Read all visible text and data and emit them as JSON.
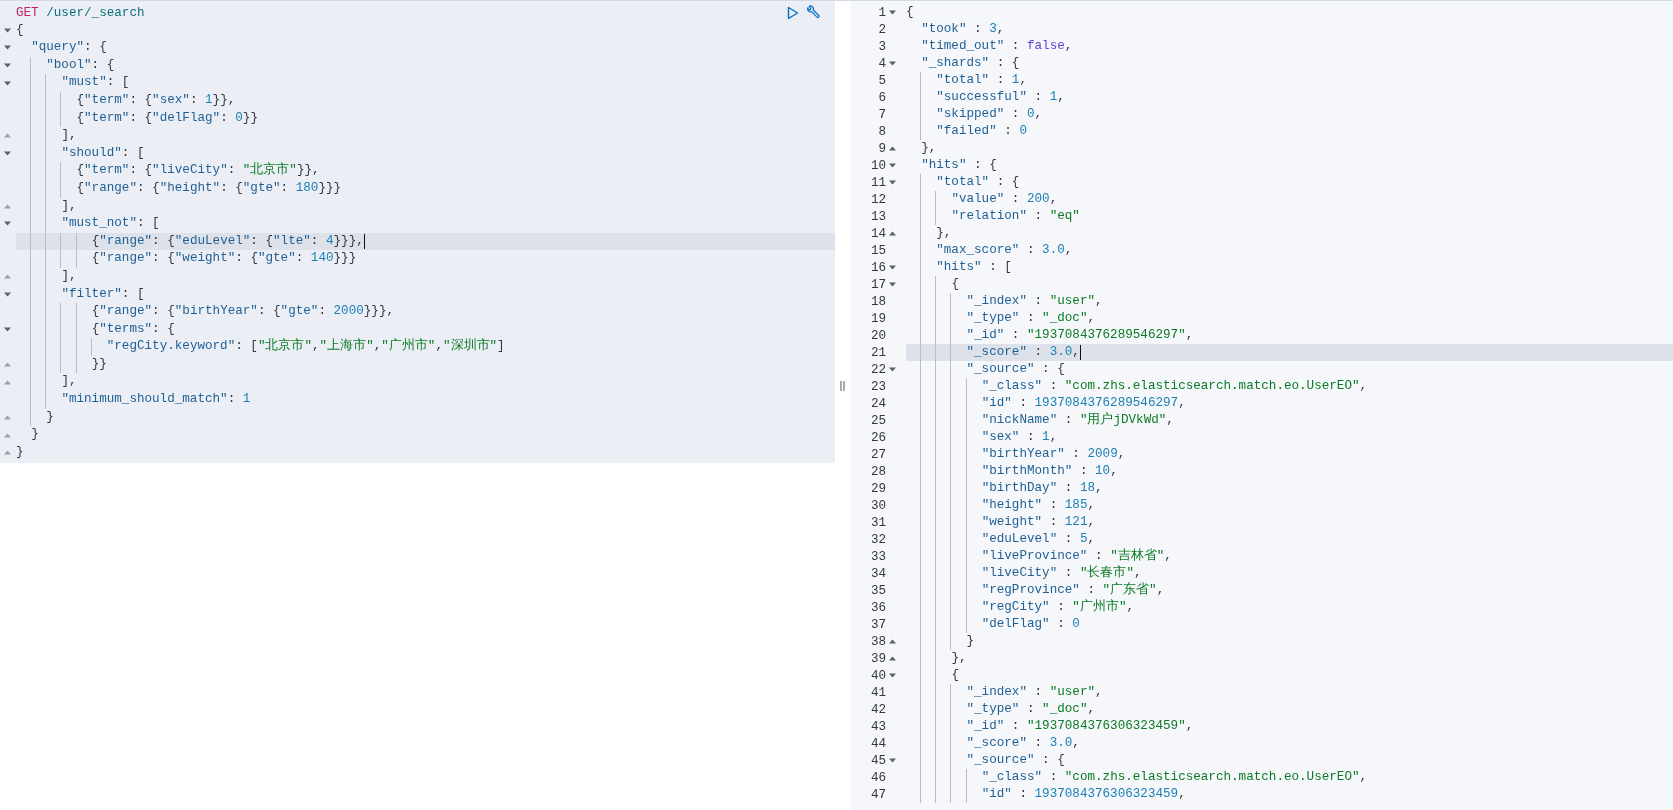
{
  "request_editor": {
    "method": "GET",
    "path": "/user/_search",
    "lines": [
      {
        "text": "{",
        "fold_start": true,
        "fold_end": false,
        "active": false
      },
      {
        "text": "  \"query\": {",
        "fold_start": true,
        "fold_end": false,
        "active": false
      },
      {
        "text": "    \"bool\": {",
        "fold_start": true,
        "fold_end": false,
        "active": false
      },
      {
        "text": "      \"must\": [",
        "fold_start": true,
        "fold_end": false,
        "active": false
      },
      {
        "text": "        {\"term\": {\"sex\": 1}},",
        "fold_start": false,
        "fold_end": false,
        "active": false
      },
      {
        "text": "        {\"term\": {\"delFlag\": 0}}",
        "fold_start": false,
        "fold_end": false,
        "active": false
      },
      {
        "text": "      ],",
        "fold_start": false,
        "fold_end": true,
        "active": false
      },
      {
        "text": "      \"should\": [",
        "fold_start": true,
        "fold_end": false,
        "active": false
      },
      {
        "text": "        {\"term\": {\"liveCity\": \"北京市\"}},",
        "fold_start": false,
        "fold_end": false,
        "active": false
      },
      {
        "text": "        {\"range\": {\"height\": {\"gte\": 180}}}",
        "fold_start": false,
        "fold_end": false,
        "active": false
      },
      {
        "text": "      ],",
        "fold_start": false,
        "fold_end": true,
        "active": false
      },
      {
        "text": "      \"must_not\": [",
        "fold_start": true,
        "fold_end": false,
        "active": false
      },
      {
        "text": "          {\"range\": {\"eduLevel\": {\"lte\": 4}}},",
        "fold_start": false,
        "fold_end": false,
        "active": true
      },
      {
        "text": "          {\"range\": {\"weight\": {\"gte\": 140}}}",
        "fold_start": false,
        "fold_end": false,
        "active": false
      },
      {
        "text": "      ],",
        "fold_start": false,
        "fold_end": true,
        "active": false
      },
      {
        "text": "      \"filter\": [",
        "fold_start": true,
        "fold_end": false,
        "active": false
      },
      {
        "text": "          {\"range\": {\"birthYear\": {\"gte\": 2000}}},",
        "fold_start": false,
        "fold_end": false,
        "active": false
      },
      {
        "text": "          {\"terms\": {",
        "fold_start": true,
        "fold_end": false,
        "active": false
      },
      {
        "text": "            \"regCity.keyword\": [\"北京市\",\"上海市\",\"广州市\",\"深圳市\"]",
        "fold_start": false,
        "fold_end": false,
        "active": false
      },
      {
        "text": "          }}",
        "fold_start": false,
        "fold_end": true,
        "active": false
      },
      {
        "text": "      ],",
        "fold_start": false,
        "fold_end": true,
        "active": false
      },
      {
        "text": "      \"minimum_should_match\": 1",
        "fold_start": false,
        "fold_end": false,
        "active": false
      },
      {
        "text": "    }",
        "fold_start": false,
        "fold_end": true,
        "active": false
      },
      {
        "text": "  }",
        "fold_start": false,
        "fold_end": true,
        "active": false
      },
      {
        "text": "}",
        "fold_start": false,
        "fold_end": true,
        "active": false
      }
    ]
  },
  "response_viewer": {
    "lines": [
      {
        "number": "1",
        "text": "{",
        "fold_start": true,
        "fold_end": false,
        "active": false
      },
      {
        "number": "2",
        "text": "  \"took\" : 3,",
        "fold_start": false,
        "fold_end": false,
        "active": false
      },
      {
        "number": "3",
        "text": "  \"timed_out\" : false,",
        "fold_start": false,
        "fold_end": false,
        "active": false
      },
      {
        "number": "4",
        "text": "  \"_shards\" : {",
        "fold_start": true,
        "fold_end": false,
        "active": false
      },
      {
        "number": "5",
        "text": "    \"total\" : 1,",
        "fold_start": false,
        "fold_end": false,
        "active": false
      },
      {
        "number": "6",
        "text": "    \"successful\" : 1,",
        "fold_start": false,
        "fold_end": false,
        "active": false
      },
      {
        "number": "7",
        "text": "    \"skipped\" : 0,",
        "fold_start": false,
        "fold_end": false,
        "active": false
      },
      {
        "number": "8",
        "text": "    \"failed\" : 0",
        "fold_start": false,
        "fold_end": false,
        "active": false
      },
      {
        "number": "9",
        "text": "  },",
        "fold_start": false,
        "fold_end": true,
        "active": false
      },
      {
        "number": "10",
        "text": "  \"hits\" : {",
        "fold_start": true,
        "fold_end": false,
        "active": false
      },
      {
        "number": "11",
        "text": "    \"total\" : {",
        "fold_start": true,
        "fold_end": false,
        "active": false
      },
      {
        "number": "12",
        "text": "      \"value\" : 200,",
        "fold_start": false,
        "fold_end": false,
        "active": false
      },
      {
        "number": "13",
        "text": "      \"relation\" : \"eq\"",
        "fold_start": false,
        "fold_end": false,
        "active": false
      },
      {
        "number": "14",
        "text": "    },",
        "fold_start": false,
        "fold_end": true,
        "active": false
      },
      {
        "number": "15",
        "text": "    \"max_score\" : 3.0,",
        "fold_start": false,
        "fold_end": false,
        "active": false
      },
      {
        "number": "16",
        "text": "    \"hits\" : [",
        "fold_start": true,
        "fold_end": false,
        "active": false
      },
      {
        "number": "17",
        "text": "      {",
        "fold_start": true,
        "fold_end": false,
        "active": false
      },
      {
        "number": "18",
        "text": "        \"_index\" : \"user\",",
        "fold_start": false,
        "fold_end": false,
        "active": false
      },
      {
        "number": "19",
        "text": "        \"_type\" : \"_doc\",",
        "fold_start": false,
        "fold_end": false,
        "active": false
      },
      {
        "number": "20",
        "text": "        \"_id\" : \"1937084376289546297\",",
        "fold_start": false,
        "fold_end": false,
        "active": false
      },
      {
        "number": "21",
        "text": "        \"_score\" : 3.0,",
        "fold_start": false,
        "fold_end": false,
        "active": true
      },
      {
        "number": "22",
        "text": "        \"_source\" : {",
        "fold_start": true,
        "fold_end": false,
        "active": false
      },
      {
        "number": "23",
        "text": "          \"_class\" : \"com.zhs.elasticsearch.match.eo.UserEO\",",
        "fold_start": false,
        "fold_end": false,
        "active": false
      },
      {
        "number": "24",
        "text": "          \"id\" : 1937084376289546297,",
        "fold_start": false,
        "fold_end": false,
        "active": false
      },
      {
        "number": "25",
        "text": "          \"nickName\" : \"用户jDVkWd\",",
        "fold_start": false,
        "fold_end": false,
        "active": false
      },
      {
        "number": "26",
        "text": "          \"sex\" : 1,",
        "fold_start": false,
        "fold_end": false,
        "active": false
      },
      {
        "number": "27",
        "text": "          \"birthYear\" : 2009,",
        "fold_start": false,
        "fold_end": false,
        "active": false
      },
      {
        "number": "28",
        "text": "          \"birthMonth\" : 10,",
        "fold_start": false,
        "fold_end": false,
        "active": false
      },
      {
        "number": "29",
        "text": "          \"birthDay\" : 18,",
        "fold_start": false,
        "fold_end": false,
        "active": false
      },
      {
        "number": "30",
        "text": "          \"height\" : 185,",
        "fold_start": false,
        "fold_end": false,
        "active": false
      },
      {
        "number": "31",
        "text": "          \"weight\" : 121,",
        "fold_start": false,
        "fold_end": false,
        "active": false
      },
      {
        "number": "32",
        "text": "          \"eduLevel\" : 5,",
        "fold_start": false,
        "fold_end": false,
        "active": false
      },
      {
        "number": "33",
        "text": "          \"liveProvince\" : \"吉林省\",",
        "fold_start": false,
        "fold_end": false,
        "active": false
      },
      {
        "number": "34",
        "text": "          \"liveCity\" : \"长春市\",",
        "fold_start": false,
        "fold_end": false,
        "active": false
      },
      {
        "number": "35",
        "text": "          \"regProvince\" : \"广东省\",",
        "fold_start": false,
        "fold_end": false,
        "active": false
      },
      {
        "number": "36",
        "text": "          \"regCity\" : \"广州市\",",
        "fold_start": false,
        "fold_end": false,
        "active": false
      },
      {
        "number": "37",
        "text": "          \"delFlag\" : 0",
        "fold_start": false,
        "fold_end": false,
        "active": false
      },
      {
        "number": "38",
        "text": "        }",
        "fold_start": false,
        "fold_end": true,
        "active": false
      },
      {
        "number": "39",
        "text": "      },",
        "fold_start": false,
        "fold_end": true,
        "active": false
      },
      {
        "number": "40",
        "text": "      {",
        "fold_start": true,
        "fold_end": false,
        "active": false
      },
      {
        "number": "41",
        "text": "        \"_index\" : \"user\",",
        "fold_start": false,
        "fold_end": false,
        "active": false
      },
      {
        "number": "42",
        "text": "        \"_type\" : \"_doc\",",
        "fold_start": false,
        "fold_end": false,
        "active": false
      },
      {
        "number": "43",
        "text": "        \"_id\" : \"1937084376306323459\",",
        "fold_start": false,
        "fold_end": false,
        "active": false
      },
      {
        "number": "44",
        "text": "        \"_score\" : 3.0,",
        "fold_start": false,
        "fold_end": false,
        "active": false
      },
      {
        "number": "45",
        "text": "        \"_source\" : {",
        "fold_start": true,
        "fold_end": false,
        "active": false
      },
      {
        "number": "46",
        "text": "          \"_class\" : \"com.zhs.elasticsearch.match.eo.UserEO\",",
        "fold_start": false,
        "fold_end": false,
        "active": false
      },
      {
        "number": "47",
        "text": "          \"id\" : 1937084376306323459,",
        "fold_start": false,
        "fold_end": false,
        "active": false
      }
    ]
  }
}
